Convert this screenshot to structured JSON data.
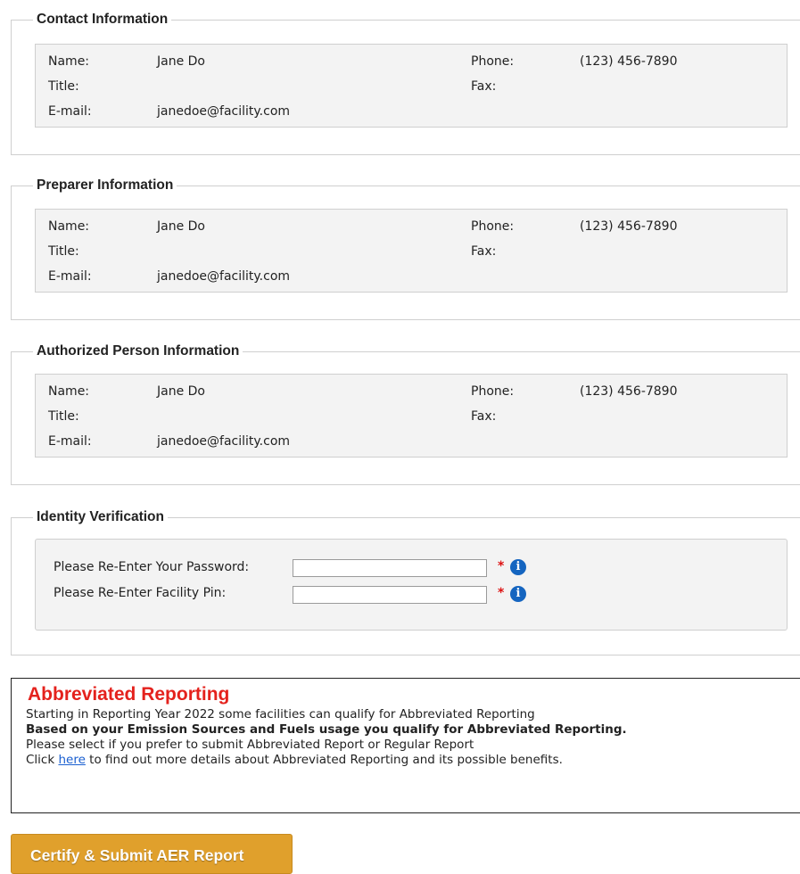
{
  "sections": [
    {
      "legend": "Contact Information",
      "name_label": "Name:",
      "name": "Jane Do",
      "title_label": "Title:",
      "title": "",
      "email_label": "E-mail:",
      "email": "janedoe@facility.com",
      "phone_label": "Phone:",
      "phone": "(123) 456-7890",
      "fax_label": "Fax:",
      "fax": ""
    },
    {
      "legend": "Preparer Information",
      "name_label": "Name:",
      "name": "Jane Do",
      "title_label": "Title:",
      "title": "",
      "email_label": "E-mail:",
      "email": "janedoe@facility.com",
      "phone_label": "Phone:",
      "phone": "(123) 456-7890",
      "fax_label": "Fax:",
      "fax": ""
    },
    {
      "legend": "Authorized Person Information",
      "name_label": "Name:",
      "name": "Jane Do",
      "title_label": "Title:",
      "title": "",
      "email_label": "E-mail:",
      "email": "janedoe@facility.com",
      "phone_label": "Phone:",
      "phone": "(123) 456-7890",
      "fax_label": "Fax:",
      "fax": ""
    }
  ],
  "identity": {
    "legend": "Identity Verification",
    "password_label": "Please Re-Enter Your Password:",
    "password_value": "",
    "pin_label": "Please Re-Enter Facility Pin:",
    "pin_value": "",
    "required_mark": "*",
    "info_glyph": "i",
    "info_icon": "info-circle-icon",
    "icon_color": "#1565c0"
  },
  "abbreviated": {
    "title": "Abbreviated Reporting",
    "line1": "Starting in Reporting Year 2022 some facilities can qualify for Abbreviated Reporting",
    "line2": "Based on your Emission Sources and Fuels usage you qualify for Abbreviated Reporting.",
    "line3": "Please select if you prefer to submit Abbreviated Report or Regular Report",
    "line4_pre": "Click ",
    "link": "here",
    "line4_post": " to find out more details about Abbreviated Reporting and its possible benefits.",
    "title_color": "#e4221d"
  },
  "submit_button": "Certify & Submit AER Report",
  "submit_color": "#e0a02c"
}
